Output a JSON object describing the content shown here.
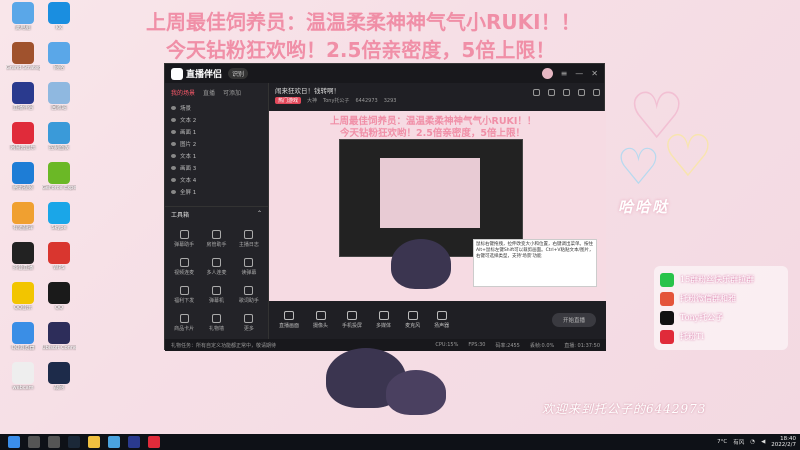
{
  "overlay": {
    "line1": "上周最佳饲养员：温温柔柔神神气气小RUKI！！",
    "line2": "今天钻粉狂欢哟！2.5倍亲密度，5倍上限！",
    "welcome": "欢迎来到托公子的6442973",
    "sparkle": "哈哈哒"
  },
  "desktop_icons": [
    {
      "label": "此电脑",
      "icon": "computer-icon",
      "color": "#5aa7e8"
    },
    {
      "label": "KK",
      "icon": "kk-app-icon",
      "color": "#1a8ee0"
    },
    {
      "label": "Grand Strategy",
      "icon": "game-icon",
      "color": "#a0522d"
    },
    {
      "label": "网络",
      "icon": "network-icon",
      "color": "#5aa7e8"
    },
    {
      "label": "直播伴侣",
      "icon": "stream-companion-icon",
      "color": "#2a3a8e"
    },
    {
      "label": "回收站",
      "icon": "recycle-bin-icon",
      "color": "#8fb8e0"
    },
    {
      "label": "网易云音乐",
      "icon": "netease-music-icon",
      "color": "#e02b3a"
    },
    {
      "label": "控制面板",
      "icon": "control-panel-icon",
      "color": "#3a9ad9"
    },
    {
      "label": "腾讯视频",
      "icon": "video-icon",
      "color": "#1e7dd6"
    },
    {
      "label": "GeForce Experience",
      "icon": "nvidia-icon",
      "color": "#6bb826"
    },
    {
      "label": "有道翻译",
      "icon": "translate-icon",
      "color": "#f0a030"
    },
    {
      "label": "Skype",
      "icon": "skype-icon",
      "color": "#1aa6e8"
    },
    {
      "label": "抖音直播",
      "icon": "douyin-icon",
      "color": "#222"
    },
    {
      "label": "WPS",
      "icon": "wps-icon",
      "color": "#d9362f"
    },
    {
      "label": "QQ音乐",
      "icon": "qq-music-icon",
      "color": "#f2c500"
    },
    {
      "label": "QQ",
      "icon": "qq-icon",
      "color": "#1a1a1a"
    },
    {
      "label": "QQ浏览器",
      "icon": "browser-icon",
      "color": "#3a8ee6"
    },
    {
      "label": "Ubisoft Connect",
      "icon": "ubisoft-icon",
      "color": "#2d2d5a"
    },
    {
      "label": "webcam",
      "icon": "webcam-icon",
      "color": "#eee"
    },
    {
      "label": "战网",
      "icon": "battlenet-icon",
      "color": "#1d2b4a"
    }
  ],
  "app": {
    "name": "直播伴侣",
    "badge": "识别",
    "sidebar_tabs": [
      "我的场景",
      "直播",
      "可添加"
    ],
    "scenes": [
      "场景",
      "文本 2",
      "画面 1",
      "图片 2",
      "文本 1",
      "画面 3",
      "文本 4",
      "全屏 1"
    ],
    "tools_title": "工具箱",
    "tools": [
      "弹幕助手",
      "房管助手",
      "主播日志",
      "视频连麦",
      "多人连麦",
      "读弹幕",
      "福利下发",
      "弹幕机",
      "歌词助手",
      "商品卡片",
      "礼物墙",
      "更多"
    ],
    "room_title": "闹来狂欢日！钱转啊！",
    "room_hot": "热门游戏",
    "room_category": "大神",
    "room_user": "Tony托公子",
    "room_id": "6442973",
    "room_count": "3293",
    "toast": "热门榜单",
    "bottom": [
      "直播画面",
      "摄像头",
      "手机投屏",
      "多媒体",
      "麦克风",
      "扬声器"
    ],
    "start_live": "开始直播",
    "status_left": "礼物任务：所有自定义功能都正常中，敬请期待",
    "stats": [
      "CPU:15%",
      "FPS:30",
      "码率:2455",
      "丢帧:0.0%",
      "直播: 01:37:50"
    ],
    "tooltip": "鼠标右键拖拽，拉伸改变大小和位置，右键调出菜单。按住Alt+鼠标左键Shift可以裁剪画面。Ctrl+V粘贴文本/图片，右键可选择类型，支持'场景'功能"
  },
  "social": [
    {
      "text": "15群粉丝快乐群拉群",
      "icon": "wechat-icon",
      "color": "#29c34a"
    },
    {
      "text": "托粉微信群和雅",
      "icon": "weibo-icon",
      "color": "#e4543a"
    },
    {
      "text": "Tony托公子",
      "icon": "tiktok-icon",
      "color": "#111"
    },
    {
      "text": "托粉Ti",
      "icon": "netease-icon",
      "color": "#e02b3a"
    }
  ],
  "taskbar": {
    "apps": [
      {
        "icon": "windows-start-icon",
        "color": "#3b8eea"
      },
      {
        "icon": "search-icon",
        "color": "#555"
      },
      {
        "icon": "task-view-icon",
        "color": "#555"
      },
      {
        "icon": "steam-icon",
        "color": "#1b2838"
      },
      {
        "icon": "explorer-icon",
        "color": "#f0c040"
      },
      {
        "icon": "chrome-icon",
        "color": "#4aa3df"
      },
      {
        "icon": "stream-companion-icon",
        "color": "#2a3a8e"
      },
      {
        "icon": "music-icon",
        "color": "#e02b3a"
      }
    ],
    "weather": "7°C",
    "wind": "有风",
    "time": "18:40",
    "date": "2022/2/7"
  }
}
